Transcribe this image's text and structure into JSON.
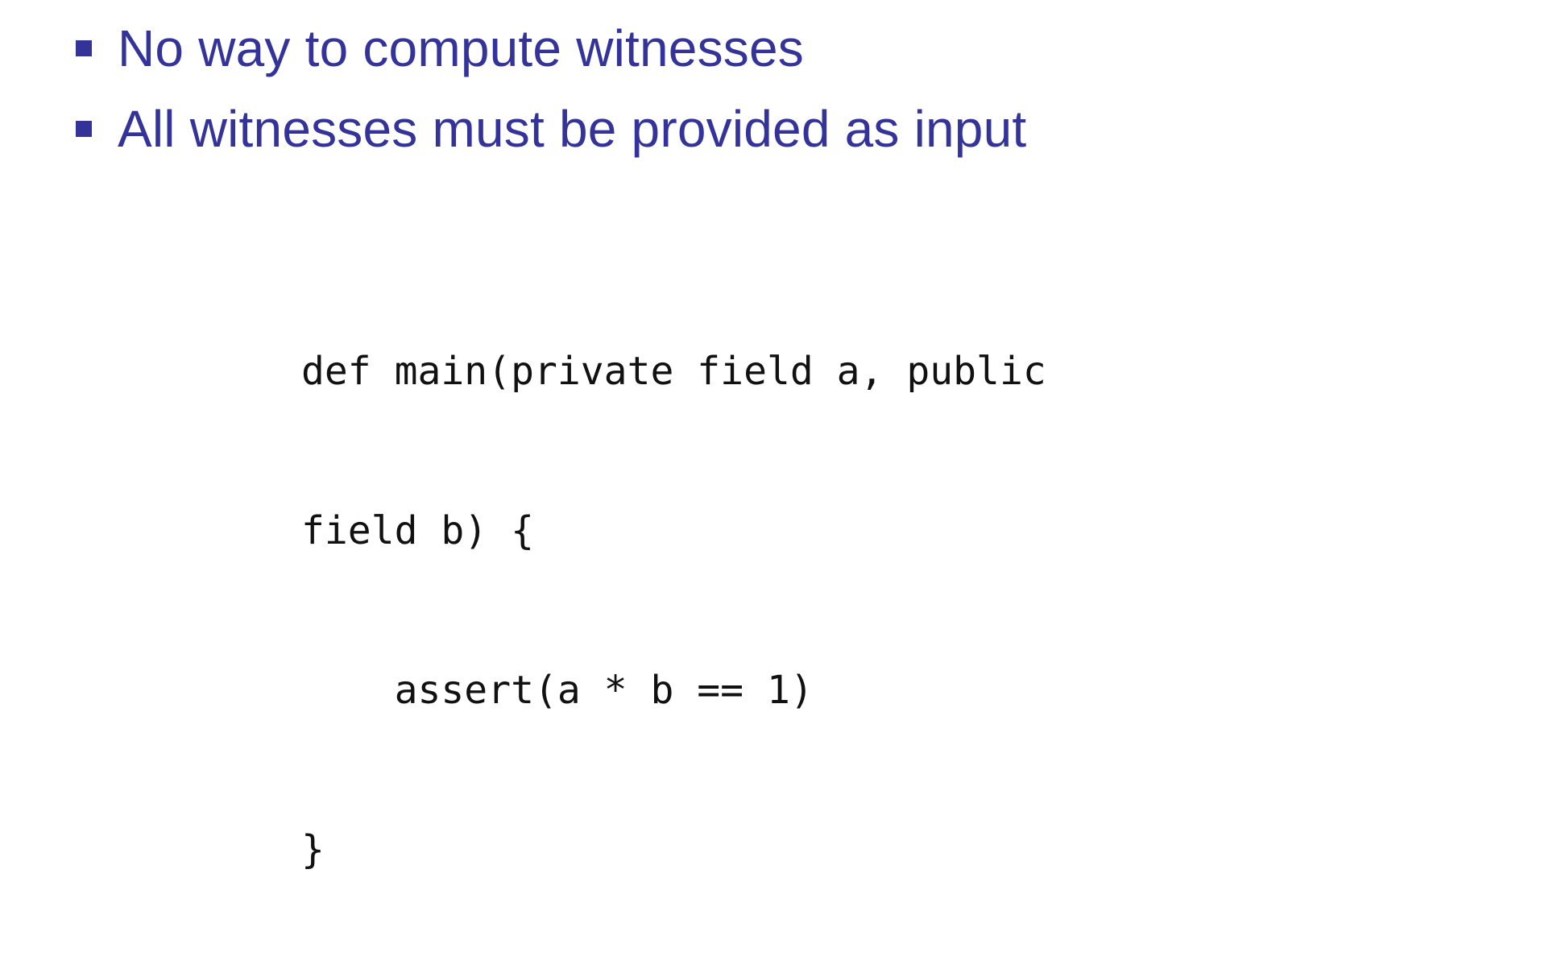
{
  "slide": {
    "bullets": [
      "No way to compute witnesses",
      "All witnesses must be provided as input"
    ],
    "code_lines": [
      "def main(private field a, public",
      "field b) {",
      "    assert(a * b == 1)",
      "}"
    ]
  },
  "colors": {
    "bullet_text": "#333399",
    "code_text": "#111111",
    "background": "#ffffff"
  }
}
